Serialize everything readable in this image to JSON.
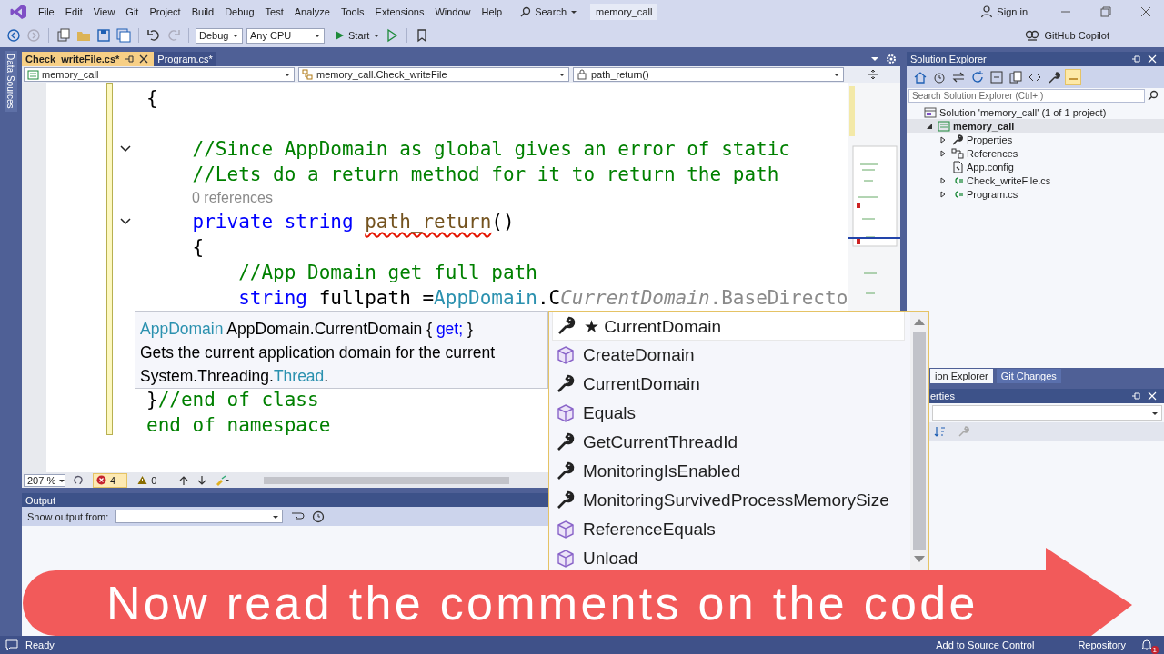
{
  "menu_bar": {
    "items": [
      "File",
      "Edit",
      "View",
      "Git",
      "Project",
      "Build",
      "Debug",
      "Test",
      "Analyze",
      "Tools",
      "Extensions",
      "Window",
      "Help"
    ],
    "search": "Search",
    "solution_name": "memory_call",
    "sign_in": "Sign in"
  },
  "toolbar": {
    "configuration": "Debug",
    "platform": "Any CPU",
    "start": "Start",
    "copilot": "GitHub Copilot"
  },
  "side_tab": "Data Sources",
  "editor": {
    "tabs": [
      {
        "label": "Check_writeFile.cs*",
        "selected": true
      },
      {
        "label": "Program.cs*",
        "selected": false
      }
    ],
    "nav": [
      "memory_call",
      "memory_call.Check_writeFile",
      "path_return()"
    ],
    "lines": [
      {
        "kind": "code",
        "tokens": [
          {
            "text": "{",
            "kind": "plain"
          }
        ]
      },
      {
        "kind": "blank"
      },
      {
        "kind": "code",
        "expanded": true,
        "tokens": [
          {
            "text": "    //Since AppDomain as global gives an error of static",
            "kind": "comment"
          }
        ]
      },
      {
        "kind": "code",
        "tokens": [
          {
            "text": "    //Lets do a return method for it to return the path",
            "kind": "comment"
          }
        ]
      },
      {
        "kind": "codelens",
        "text": "0 references"
      },
      {
        "kind": "code",
        "expanded": true,
        "tokens": [
          {
            "text": "    private string ",
            "kind": "keyword"
          },
          {
            "text": "path_return",
            "kind": "method",
            "squiggle": true
          },
          {
            "text": "()",
            "kind": "plain"
          }
        ]
      },
      {
        "kind": "code",
        "tokens": [
          {
            "text": "    {",
            "kind": "plain"
          }
        ]
      },
      {
        "kind": "code",
        "tokens": [
          {
            "text": "        //App Domain get full path",
            "kind": "comment"
          }
        ]
      },
      {
        "kind": "code",
        "tokens": [
          {
            "text": "        string",
            "kind": "keyword"
          },
          {
            "text": " fullpath =",
            "kind": "plain"
          },
          {
            "text": "AppDomain",
            "kind": "type"
          },
          {
            "text": ".C",
            "kind": "plain"
          },
          {
            "text": "CurrentDomain",
            "kind": "ghost"
          },
          {
            "text": ".BaseDirecto",
            "kind": "ghost_plain"
          }
        ]
      },
      {
        "kind": "blank"
      },
      {
        "kind": "blank"
      },
      {
        "kind": "blank"
      },
      {
        "kind": "code",
        "tokens": [
          {
            "text": "}",
            "kind": "plain"
          },
          {
            "text": "//end of class",
            "kind": "comment"
          }
        ]
      },
      {
        "kind": "code",
        "tokens": [
          {
            "text": "end of namespace",
            "kind": "comment"
          }
        ]
      }
    ],
    "quick_info": [
      [
        {
          "text": "AppDomain",
          "kind": "type"
        },
        {
          "text": " AppDomain.CurrentDomain { ",
          "kind": "plain"
        },
        {
          "text": "get;",
          "kind": "keyword"
        },
        {
          "text": " }",
          "kind": "plain"
        }
      ],
      [
        {
          "text": "Gets the current application domain for the current",
          "kind": "plain"
        }
      ],
      [
        {
          "text": "System.Threading.",
          "kind": "plain"
        },
        {
          "text": "Thread",
          "kind": "type"
        },
        {
          "text": ".",
          "kind": "plain"
        }
      ]
    ],
    "completion": [
      {
        "label": "★ CurrentDomain",
        "kind": "property",
        "selected": true
      },
      {
        "label": "CreateDomain",
        "kind": "method",
        "selected": false
      },
      {
        "label": "CurrentDomain",
        "kind": "property",
        "selected": false
      },
      {
        "label": "Equals",
        "kind": "method",
        "selected": false
      },
      {
        "label": "GetCurrentThreadId",
        "kind": "property",
        "selected": false
      },
      {
        "label": "MonitoringIsEnabled",
        "kind": "property",
        "selected": false
      },
      {
        "label": "MonitoringSurvivedProcessMemorySize",
        "kind": "property",
        "selected": false
      },
      {
        "label": "ReferenceEquals",
        "kind": "method",
        "selected": false
      },
      {
        "label": "Unload",
        "kind": "method",
        "selected": false
      }
    ],
    "status": {
      "zoom": "207 %",
      "errors": "4",
      "warnings": "0"
    }
  },
  "output": {
    "title": "Output",
    "show_from_label": "Show output from:"
  },
  "solution_explorer": {
    "title": "Solution Explorer",
    "search_placeholder": "Search Solution Explorer (Ctrl+;)",
    "tree": [
      {
        "label": "Solution 'memory_call' (1 of 1 project)",
        "kind": "solution",
        "selected": false,
        "children": [
          {
            "label": "memory_call",
            "kind": "project",
            "expanded": true,
            "selected": true,
            "children": [
              {
                "label": "Properties",
                "kind": "properties",
                "expanded": false,
                "selected": false
              },
              {
                "label": "References",
                "kind": "references",
                "expanded": false,
                "selected": false
              },
              {
                "label": "App.config",
                "kind": "config",
                "selected": false
              },
              {
                "label": "Check_writeFile.cs",
                "kind": "csharp",
                "expanded": false,
                "selected": false
              },
              {
                "label": "Program.cs",
                "kind": "csharp",
                "expanded": false,
                "selected": false
              }
            ]
          }
        ]
      }
    ]
  },
  "panel_tabs": [
    {
      "label": "ion Explorer",
      "selected": true
    },
    {
      "label": "Git Changes",
      "selected": false
    }
  ],
  "properties": {
    "title": "erties"
  },
  "banner": {
    "text": "Now read the comments on the code"
  },
  "status_bar": {
    "text": "Ready",
    "source_control": "Add to Source Control",
    "repository": "Repository",
    "notifications": "1"
  }
}
